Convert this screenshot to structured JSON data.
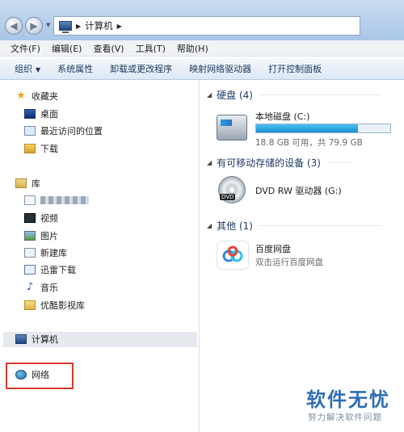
{
  "address_bar": {
    "path": [
      "计算机"
    ]
  },
  "menu": [
    "文件(F)",
    "编辑(E)",
    "查看(V)",
    "工具(T)",
    "帮助(H)"
  ],
  "toolbar": {
    "organize": "组织",
    "items": [
      "系统属性",
      "卸载或更改程序",
      "映射网络驱动器",
      "打开控制面板"
    ]
  },
  "nav": {
    "favorites": {
      "label": "收藏夹",
      "items": [
        "桌面",
        "最近访问的位置",
        "下载"
      ]
    },
    "libraries": {
      "label": "库",
      "items": [
        "视频",
        "图片",
        "新建库",
        "迅雷下载",
        "音乐",
        "优酷影视库"
      ]
    },
    "computer": "计算机",
    "network": "网络"
  },
  "main": {
    "hard_disks": {
      "label": "硬盘 (4)",
      "drives": [
        {
          "name": "本地磁盘 (C:)",
          "space": "18.8 GB 可用，共 79.9 GB",
          "used_fraction": 0.76
        }
      ]
    },
    "removable": {
      "label": "有可移动存储的设备 (3)",
      "drives": [
        {
          "name": "DVD RW 驱动器 (G:)"
        }
      ]
    },
    "other": {
      "label": "其他 (1)",
      "items": [
        {
          "name": "百度网盘",
          "desc": "双击运行百度网盘"
        }
      ]
    }
  },
  "watermark": {
    "title": "软件无忧",
    "subtitle": "努力解决软件问题"
  },
  "colors": {
    "highlight_box": "#d9382f",
    "accent": "#2f6db4"
  }
}
